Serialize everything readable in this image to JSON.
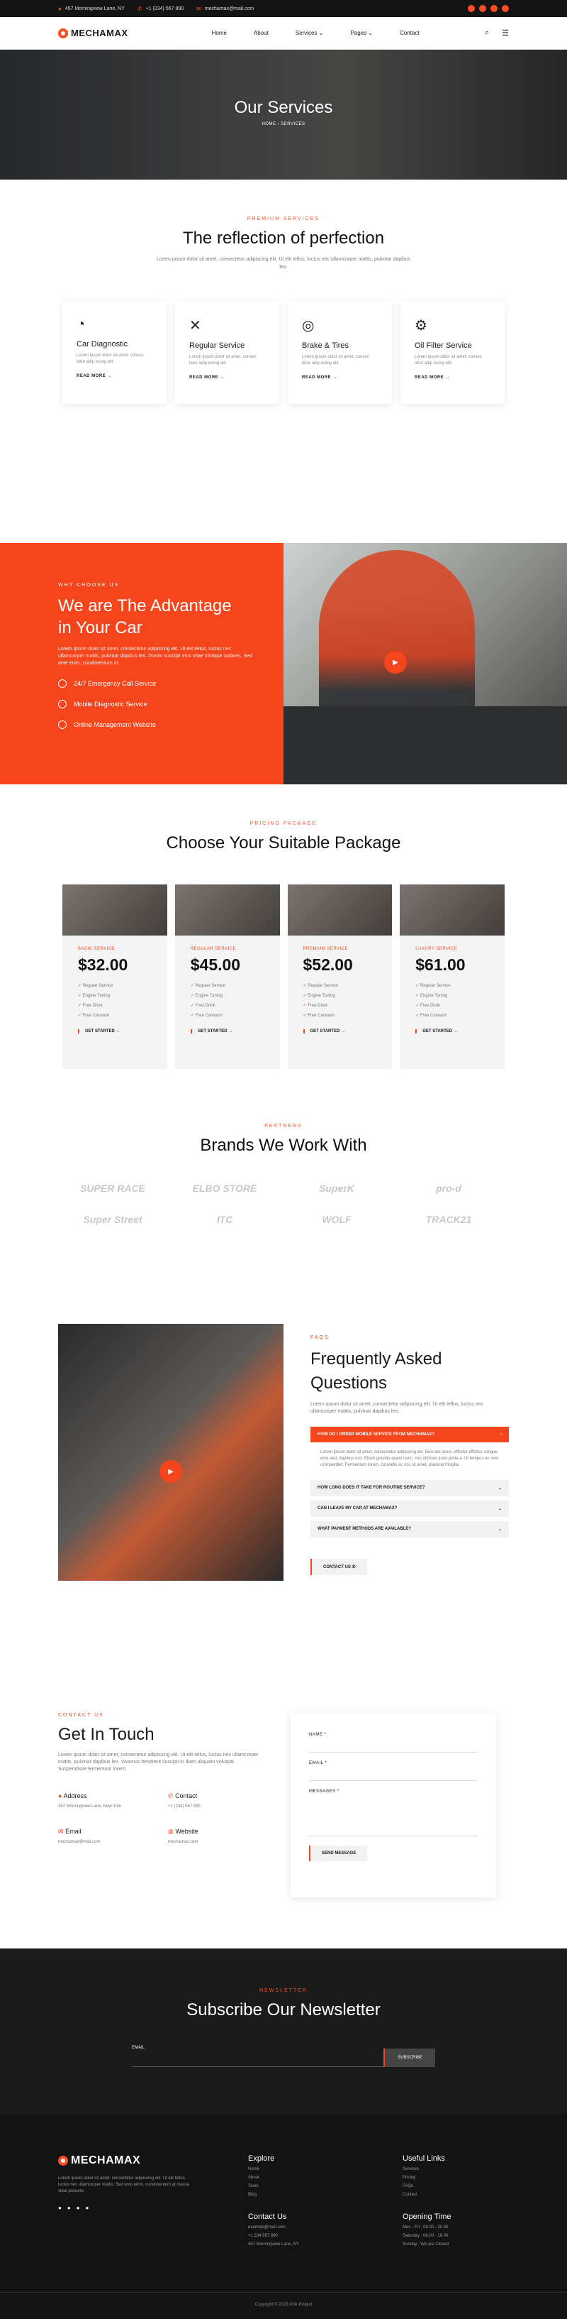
{
  "topbar": {
    "address": "457 Morningview Lane, NY",
    "phone": "+1 (234) 567 890",
    "email": "mechamax@mail.com"
  },
  "nav": {
    "logo": "MECHAMAX",
    "items": [
      {
        "label": "Home"
      },
      {
        "label": "About"
      },
      {
        "label": "Services",
        "active": true
      },
      {
        "label": "Pages"
      },
      {
        "label": "Contact"
      }
    ]
  },
  "hero": {
    "title": "Our Services",
    "home": "HOME",
    "sep": "›",
    "current": "SERVICES"
  },
  "services": {
    "eyebrow": "PREMIUM SERVICES",
    "title": "The reflection of perfection",
    "subtitle": "Lorem ipsum dolor sit amet, consectetur adipiscing elit. Ut elit tellus, luctus nec ullamcorper mattis, pulvinar dapibus leo.",
    "cards": [
      {
        "icon": "gauge-icon",
        "glyph": "◔",
        "title": "Car Diagnostic",
        "text": "Lorem ipsum dolor sit amet, consec tetur adip iscing elit.",
        "link": "READ MORE"
      },
      {
        "icon": "tools-icon",
        "glyph": "✕",
        "title": "Regular Service",
        "text": "Lorem ipsum dolor sit amet, consec tetur adip iscing elit.",
        "link": "READ MORE"
      },
      {
        "icon": "tire-icon",
        "glyph": "◎",
        "title": "Brake & Tires",
        "text": "Lorem ipsum dolor sit amet, consec tetur adip iscing elit.",
        "link": "READ MORE"
      },
      {
        "icon": "gears-icon",
        "glyph": "⚙",
        "title": "Oil Filter Service",
        "text": "Lorem ipsum dolor sit amet, consec tetur adip iscing elit.",
        "link": "READ MORE"
      }
    ]
  },
  "why": {
    "eyebrow": "WHY CHOOSE US",
    "title1": "We are The Advantage",
    "title2": "in Your Car",
    "text": "Lorem ipsum dolor sit amet, consectetur adipiscing elit. Ut elit tellus, luctus nec ullamcorper mattis, pulvinar dapibus leo. Donec suscipit eros vitae tristique sodales. Sed ante enim, condimentum at.",
    "items": [
      "24/7 Emergency Call Service",
      "Mobile Diagnostic Service",
      "Online Management Website"
    ]
  },
  "pricing": {
    "eyebrow": "PRICING PACKAGE",
    "title": "Choose Your Suitable Package",
    "plans": [
      {
        "name": "BASIC SERVICE",
        "price": "$32.00"
      },
      {
        "name": "REGULAR SERVICE",
        "price": "$45.00"
      },
      {
        "name": "PREMIUM SERVICE",
        "price": "$52.00"
      },
      {
        "name": "LUXURY SERVICE",
        "price": "$61.00"
      }
    ],
    "features": [
      "Regular Service",
      "Engine Tuning",
      "Free Drink",
      "Free Carwash"
    ],
    "cta": "GET STARTED"
  },
  "brands": {
    "eyebrow": "PARTNERS",
    "title": "Brands We Work With",
    "logos": [
      "SUPER RACE",
      "ELBO STORE",
      "SuperK",
      "pro-d",
      "Super Street",
      "ITC",
      "WOLF",
      "TRACK21"
    ]
  },
  "faq": {
    "eyebrow": "FAQS",
    "title1": "Frequently Asked",
    "title2": "Questions",
    "text": "Lorem ipsum dolor sit amet, consectetur adipiscing elit. Ut elit tellus, luctus nec ullamcorper mattis, pulvinar dapibus leo.",
    "open_q": "HOW DO I ORDER MOBILE SERVICE FROM MECHAMAX?",
    "answer": "Lorem ipsum dolor sit amet, consectetur adipiscing elit. Duis leo lacus, efficitur efficitur congue eros sed, dapibus orci. Etiam gravida quam nunc, nec ultricies justo porta a. Ut tempus ac sem ut imperdiet. Fermentum lorem, convallis ac nisi sit amet, placerat fringilla.",
    "questions": [
      "HOW LONG DOES IT TAKE FOR ROUTINE SERVICE?",
      "CAN I LEAVE MY CAR AT MECHAMAX?",
      "WHAT PAYMENT METHODS ARE AVAILABLE?"
    ],
    "cta": "CONTACT US"
  },
  "contact": {
    "eyebrow": "CONTACT US",
    "title": "Get In Touch",
    "text": "Lorem ipsum dolor sit amet, consectetur adipiscing elit. Ut elit tellus, luctus nec ullamcorper mattis, pulvinar dapibus leo. Vivamus hendrerit suscipit in diam aliquam volutpat. Suspendisse fermentum lorem.",
    "address_label": "Address",
    "address": "457 Morningview Lane, New York",
    "contact_label": "Contact",
    "phone": "+1 (234) 567 890",
    "email_label": "Email",
    "email": "mechamax@mail.com",
    "website_label": "Website",
    "website": "mechamax.com",
    "form": {
      "name": "NAME *",
      "email": "EMAIL *",
      "messages": "MESSAGES *",
      "submit": "SEND MESSAGE"
    }
  },
  "newsletter": {
    "eyebrow": "NEWSLETTER",
    "title": "Subscribe Our Newsletter",
    "email": "EMAIL",
    "cta": "SUBSCRIBE"
  },
  "footer": {
    "logo": "MECHAMAX",
    "text": "Lorem ipsum dolor sit amet, consectetur adipiscing elit. Ut elit tellus, luctus nec ullamcorper mattis. Sed eros enim, condimentum at massa vitae posuere.",
    "explore_title": "Explore",
    "explore": [
      "Home",
      "About",
      "Team",
      "Blog"
    ],
    "useful_title": "Useful Links",
    "useful": [
      "Services",
      "Pricing",
      "FAQs",
      "Contact"
    ],
    "contact_title": "Contact Us",
    "contact": [
      "example@mail.com",
      "+1 234 567 890",
      "457 Morningview Lane, NY"
    ],
    "hours_title": "Opening Time",
    "hours": [
      "Mon - Fri : 08.00 - 20.00",
      "Saturday : 08.00 - 18.00",
      "Sunday : We are Closed"
    ],
    "copyright": "Copyright © 2023 ASK Project"
  }
}
